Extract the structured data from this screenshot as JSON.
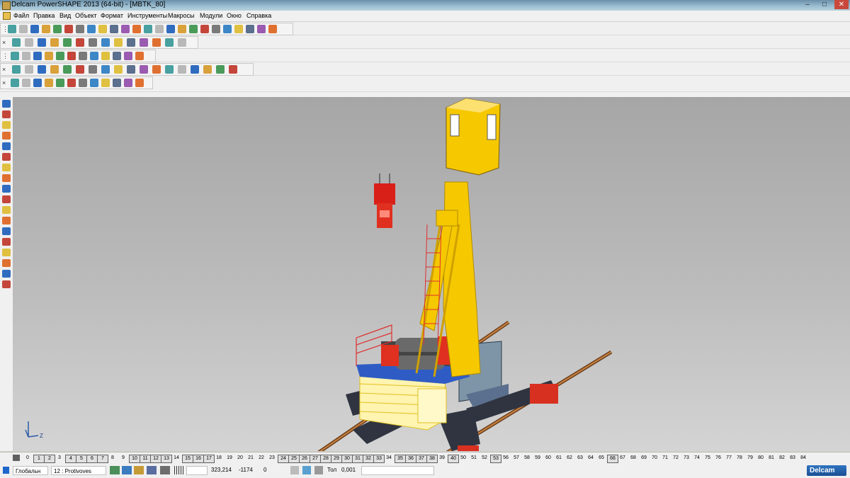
{
  "window": {
    "title": "Delcam PowerSHAPE 2013 (64-bit) - [MBTK_80]",
    "controls": [
      "–",
      "□",
      "✕"
    ]
  },
  "menu": {
    "items": [
      "Файл",
      "Правка",
      "Вид",
      "Объект",
      "Формат",
      "Инструменты",
      "Макросы",
      "Модули",
      "Окно",
      "Справка"
    ]
  },
  "toolbars": {
    "close_glyph": "×",
    "row1_icons": [
      "new-icon",
      "open-icon",
      "save-icon",
      "save-as-icon",
      "import-icon",
      "print-icon",
      "cut-icon",
      "copy-icon",
      "paste-icon",
      "redo-icon",
      "delete-icon",
      "undo-icon",
      "undo-history-icon",
      "text-icon",
      "measure-icon",
      "distance-icon",
      "line-icon",
      "circle-icon",
      "curve-icon",
      "arc-icon",
      "surface-icon",
      "solid-icon",
      "wireframe-icon",
      "tools-icon"
    ],
    "row2_icons": [
      "view-front-icon",
      "view-top-icon",
      "view-side-icon",
      "view-iso-icon",
      "view-3d-icon",
      "rotate-icon",
      "zoom-icon",
      "zoom-fit-icon",
      "zoom-area-icon",
      "pan-icon",
      "shade-icon",
      "render-icon",
      "light-icon",
      "hand-icon"
    ],
    "row3_icons": [
      "layer-icon",
      "document-icon",
      "materials-icon",
      "color-icon",
      "sphere-icon",
      "cone-icon",
      "arrow-icon",
      "box-icon",
      "cube-icon",
      "grid-icon",
      "select-icon",
      "group-icon"
    ],
    "row4_icons": [
      "view-plane-icon",
      "view-box-icon",
      "view-shade-icon",
      "view-shade2-icon",
      "view-wire-icon",
      "view-wire2-icon",
      "view-hidden-icon",
      "view-light-icon",
      "view-mat-icon",
      "view-solid-icon",
      "view-solid2-icon",
      "view-solid3-icon",
      "view-edges-icon",
      "view-cap-icon",
      "view-cap2-icon",
      "view-cap3-icon",
      "view-section-icon",
      "view-section2-icon"
    ],
    "row5_icons": [
      "workplane-icon",
      "axis-icon",
      "cube-blue-icon",
      "cube-green-icon",
      "stack-icon",
      "stack2-icon",
      "stack3-icon",
      "pattern-icon",
      "grid2-icon",
      "tree-icon",
      "merge-icon",
      "split-icon"
    ]
  },
  "left_toolbar": {
    "icons": [
      "select-arrow-icon",
      "multi-select-icon",
      "copy-obj-icon",
      "move-obj-icon",
      "rotate-obj-icon",
      "mirror-obj-icon",
      "scale-obj-icon",
      "offset-icon",
      "extrude-icon",
      "revolve-icon",
      "sweep-icon",
      "loft-icon",
      "fillet-icon",
      "chamfer-icon",
      "shell-icon",
      "boolean-icon",
      "cut-icon",
      "feature-icon"
    ]
  },
  "viewport": {
    "axis_label": "Z"
  },
  "levels": {
    "items": [
      "0",
      "1",
      "2",
      "3",
      "4",
      "5",
      "6",
      "7",
      "8",
      "9",
      "10",
      "11",
      "12",
      "13",
      "14",
      "15",
      "16",
      "17",
      "18",
      "19",
      "20",
      "21",
      "22",
      "23",
      "24",
      "25",
      "26",
      "27",
      "28",
      "29",
      "30",
      "31",
      "32",
      "33",
      "34",
      "35",
      "36",
      "37",
      "38",
      "39",
      "40",
      "50",
      "51",
      "52",
      "53",
      "56",
      "57",
      "58",
      "59",
      "60",
      "61",
      "62",
      "63",
      "64",
      "65",
      "66",
      "67",
      "68",
      "69",
      "70",
      "71",
      "72",
      "73",
      "74",
      "75",
      "76",
      "77",
      "78",
      "79",
      "80",
      "81",
      "82",
      "83",
      "84"
    ],
    "active": [
      "1",
      "2",
      "4",
      "5",
      "6",
      "7",
      "10",
      "11",
      "12",
      "13",
      "15",
      "16",
      "17",
      "24",
      "25",
      "26",
      "27",
      "28",
      "29",
      "30",
      "31",
      "32",
      "33",
      "35",
      "36",
      "37",
      "38",
      "40",
      "53",
      "66"
    ]
  },
  "status": {
    "coord_system": "Глобальн",
    "level": "12 : Protivoves",
    "x": "323,214",
    "y": "-1174",
    "z": "0",
    "tolerance_label": "Тол",
    "tolerance": "0,001",
    "brand": "Delcam"
  }
}
